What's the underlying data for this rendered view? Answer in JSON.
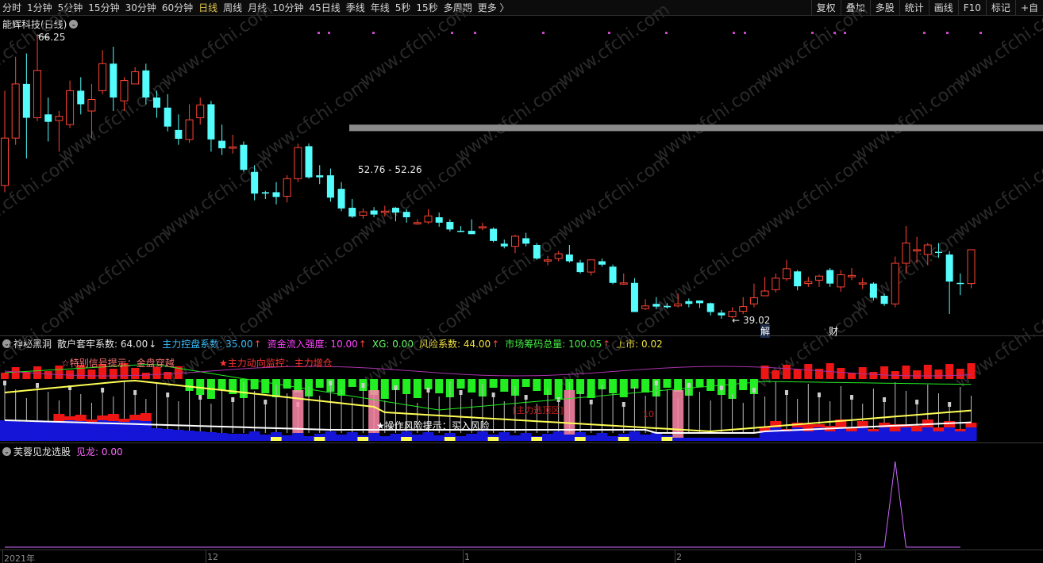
{
  "toolbar": {
    "periods": [
      "分时",
      "1分钟",
      "5分钟",
      "15分钟",
      "30分钟",
      "60分钟",
      "日线",
      "周线",
      "月线",
      "10分钟",
      "45日线",
      "季线",
      "年线",
      "5秒",
      "15秒",
      "多周期",
      "更多 〉"
    ],
    "active": "日线",
    "right": [
      "复权",
      "叠加",
      "多股",
      "统计",
      "画线",
      "F10",
      "标记",
      "+自"
    ]
  },
  "main": {
    "title": "能辉科技(日线)",
    "high_label": "66.25",
    "low_label": "39.02",
    "range_label": "52.76 - 52.26",
    "markers": [
      "解",
      "财"
    ]
  },
  "panel1": {
    "name": "神秘黑洞",
    "items": [
      {
        "label": "散户套牢系数: 64.00",
        "arrow": "↓",
        "color": "#e6e6e6",
        "arrow_color": "#e6e6e6"
      },
      {
        "label": "主力控盘系数: 35.00",
        "arrow": "↑",
        "color": "#39c0ff",
        "arrow_color": "#ff4040"
      },
      {
        "label": "资金流入强度: 10.00",
        "arrow": "↑",
        "color": "#ff44ff",
        "arrow_color": "#ff4040"
      },
      {
        "label": "XG: 0.00",
        "arrow": "",
        "color": "#66ff66",
        "arrow_color": "#ff4040"
      },
      {
        "label": "风险系数: 44.00",
        "arrow": "↑",
        "color": "#f0e040",
        "arrow_color": "#ff4040"
      },
      {
        "label": "市场筹码总量: 100.05",
        "arrow": "↑",
        "color": "#44ee44",
        "arrow_color": "#ff4040"
      },
      {
        "label": "上市: 0.02",
        "arrow": "",
        "color": "#f0e040",
        "arrow_color": "#ff4040"
      }
    ],
    "notes": {
      "special": "☆特别信号提示：金盘穿越",
      "main_force": "★主力动向监控：主力增仓",
      "risk": "★操作风险提示：买入风险",
      "bottom": "[主力逃顶区]",
      "fifty": "10"
    }
  },
  "panel2": {
    "name": "芙蓉见龙选股",
    "item": "见龙: 0.00"
  },
  "xaxis": {
    "labels": [
      "2021年",
      "12",
      "1",
      "2",
      "3"
    ]
  },
  "watermark": "www.cfchi.com",
  "colors": {
    "up": "#ff4433",
    "down": "#54fcfc",
    "bg": "#000000",
    "yellow": "#ffff55",
    "blue": "#1515d8",
    "green": "#22ee22",
    "red": "#ee1515",
    "pink": "#ff88aa",
    "magenta": "#cc66ff"
  },
  "candles": [
    [
      44,
      51,
      58,
      43
    ],
    [
      51,
      59,
      63,
      50
    ],
    [
      59,
      54,
      63.5,
      48
    ],
    [
      54,
      61,
      66.25,
      53.5
    ],
    [
      54.5,
      53.4,
      57,
      50.5
    ],
    [
      53.6,
      54.2,
      55,
      49
    ],
    [
      53,
      58,
      59.5,
      52.5
    ],
    [
      58,
      56,
      60,
      54.5
    ],
    [
      55,
      56.7,
      59,
      51
    ],
    [
      58,
      62,
      64,
      57.5
    ],
    [
      62,
      57,
      64.5,
      55
    ],
    [
      56.5,
      59.5,
      60,
      55
    ],
    [
      59,
      60.8,
      61.5,
      59
    ],
    [
      61,
      57,
      62,
      56
    ],
    [
      57,
      55.5,
      58,
      54
    ],
    [
      55.5,
      52.7,
      57.5,
      52
    ],
    [
      52.2,
      50.9,
      54.5,
      50
    ],
    [
      50.8,
      53.7,
      56,
      50.3
    ],
    [
      54,
      55.9,
      57,
      53
    ],
    [
      56,
      50.8,
      56.5,
      49
    ],
    [
      50.6,
      49.5,
      53,
      48.5
    ],
    [
      49.5,
      49.7,
      51.5,
      48.7
    ],
    [
      50,
      46.3,
      50.5,
      46
    ],
    [
      46,
      42.8,
      47,
      41.8
    ],
    [
      43,
      42.8,
      43.2,
      42
    ],
    [
      43,
      42.3,
      44.5,
      41.2
    ],
    [
      42.4,
      45,
      45.5,
      41.5
    ],
    [
      45,
      49.6,
      50.2,
      44.5
    ],
    [
      49.8,
      45.2,
      50.2,
      45
    ],
    [
      45.5,
      45.2,
      47,
      44.2
    ],
    [
      45.5,
      42.2,
      46.5,
      41.6
    ],
    [
      43.5,
      40.6,
      44.5,
      40.2
    ],
    [
      40.7,
      39.4,
      42,
      39.2
    ],
    [
      39.6,
      40.1,
      40.6,
      39.1
    ],
    [
      40.3,
      39.7,
      40.8,
      39.3
    ],
    [
      40,
      40.2,
      41,
      39.4
    ],
    [
      40.7,
      40,
      40.8,
      38.7
    ],
    [
      40.1,
      39.3,
      40.5,
      38.5
    ],
    [
      38.5,
      38.5,
      39,
      38.2
    ],
    [
      38.6,
      39.5,
      40.5,
      38.3
    ],
    [
      39.3,
      38.5,
      40,
      37.9
    ],
    [
      38.6,
      37.5,
      39,
      37.2
    ],
    [
      37.3,
      37.2,
      38,
      37.1
    ],
    [
      37.3,
      36.8,
      39,
      37.1
    ],
    [
      37.9,
      37.9,
      38.5,
      37.4
    ],
    [
      37.6,
      35.8,
      37.8,
      35.6
    ],
    [
      35.4,
      35,
      36,
      34.7
    ],
    [
      35,
      36.5,
      36.7,
      34
    ],
    [
      36.2,
      35.4,
      37,
      35
    ],
    [
      35.2,
      33.2,
      35.5,
      33
    ],
    [
      33,
      33,
      33.6,
      32.2
    ],
    [
      33.2,
      33.9,
      34.3,
      32.8
    ],
    [
      33.8,
      32.8,
      35.2,
      32.6
    ],
    [
      32.6,
      31.2,
      33,
      31
    ],
    [
      31.2,
      33,
      33,
      30.7
    ],
    [
      32.8,
      32.3,
      33.2,
      32
    ],
    [
      32,
      29.6,
      32.3,
      29.4
    ],
    [
      29.6,
      29.6,
      31,
      29.3
    ],
    [
      29.6,
      25.3,
      30.3,
      25.3
    ],
    [
      25.8,
      26.2,
      27.2,
      25.6
    ],
    [
      26.5,
      26.1,
      27.5,
      25.7
    ],
    [
      26.2,
      26,
      26.6,
      25.8
    ],
    [
      26.2,
      26.5,
      28,
      26
    ],
    [
      26.9,
      26.5,
      27.3,
      26
    ],
    [
      27,
      26.6,
      26.8,
      25.9
    ],
    [
      26.6,
      25.3,
      26.7,
      24.8
    ],
    [
      25.2,
      24.8,
      25.6,
      24.3
    ],
    [
      24.6,
      25.4,
      26,
      24.4
    ],
    [
      25.4,
      26.1,
      27.5,
      25
    ],
    [
      26.5,
      27.4,
      29.5,
      26
    ],
    [
      27.7,
      28.4,
      30.5,
      27.8
    ],
    [
      28.6,
      30.3,
      31,
      28.2
    ],
    [
      30.2,
      31.7,
      33,
      29.9
    ],
    [
      31.3,
      29.1,
      31.5,
      28.5
    ],
    [
      29.5,
      29.8,
      30.5,
      29
    ],
    [
      30,
      30.6,
      30.8,
      29
    ],
    [
      31.5,
      29.5,
      31.8,
      29
    ],
    [
      29,
      30.8,
      31.5,
      28.3
    ],
    [
      30.5,
      30.7,
      31.8,
      30
    ],
    [
      29.6,
      29.6,
      30.3,
      28.7
    ],
    [
      29.5,
      27.4,
      29.7,
      27
    ],
    [
      27.7,
      26.5,
      28,
      26.2
    ],
    [
      26.5,
      32.5,
      33.5,
      26
    ],
    [
      32.5,
      35.5,
      38,
      31
    ],
    [
      34.5,
      34.5,
      36.4,
      32.5
    ],
    [
      33.8,
      35.2,
      35.5,
      32.2
    ],
    [
      34.2,
      34.1,
      35.5,
      33.3
    ],
    [
      33.8,
      29.8,
      34.3,
      25
    ],
    [
      29.6,
      29.5,
      31,
      27.8
    ],
    [
      29.5,
      34.5,
      34.5,
      28.8
    ]
  ],
  "panel2_series": [
    0,
    0,
    0,
    0,
    0,
    0,
    0,
    0,
    0,
    0,
    0,
    0,
    0,
    0,
    0,
    0,
    0,
    0,
    0,
    0,
    0,
    0,
    0,
    0,
    0,
    0,
    0,
    0,
    0,
    0,
    0,
    0,
    0,
    0,
    0,
    0,
    0,
    0,
    0,
    0,
    0,
    0,
    0,
    0,
    0,
    0,
    0,
    0,
    0,
    0,
    0,
    0,
    0,
    0,
    0,
    0,
    0,
    0,
    0,
    0,
    0,
    0,
    0,
    0,
    0,
    0,
    0,
    0,
    0,
    0,
    0,
    0,
    0,
    0,
    0,
    0,
    0,
    0,
    0,
    0,
    0,
    0,
    100,
    0,
    0,
    0,
    0,
    0,
    0
  ]
}
